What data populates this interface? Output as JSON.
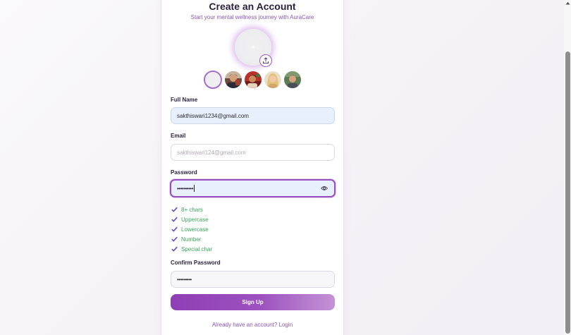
{
  "form": {
    "title": "Create an Account",
    "subtitle": "Start your mental wellness journey with AuraCare",
    "full_name": {
      "label": "Full Name",
      "value": "sakthiswari1234@gmail.com"
    },
    "email": {
      "label": "Email",
      "placeholder": "sakthiswari124@gmail.com"
    },
    "password": {
      "label": "Password",
      "value": "••••••••••"
    },
    "requirements": [
      "8+ chars",
      "Uppercase",
      "Lowercase",
      "Number",
      "Special char"
    ],
    "confirm_password": {
      "label": "Confirm Password",
      "value": "•••••••••"
    },
    "signup_label": "Sign Up",
    "login_text": "Already have an account? Login"
  },
  "avatar": {
    "upload_icon": "upload-icon",
    "presets": [
      "default-avatar",
      "avatar-1",
      "avatar-2",
      "avatar-3",
      "avatar-4"
    ]
  },
  "colors": {
    "accent": "#9a4fc1",
    "subtitle": "#8a56b4",
    "check_green": "#3aa55a",
    "check_icon": "#6a4fc4",
    "input_filled_bg": "#e8f0fe",
    "button_gradient_start": "#8f3fb4",
    "button_gradient_end": "#c493d6"
  }
}
